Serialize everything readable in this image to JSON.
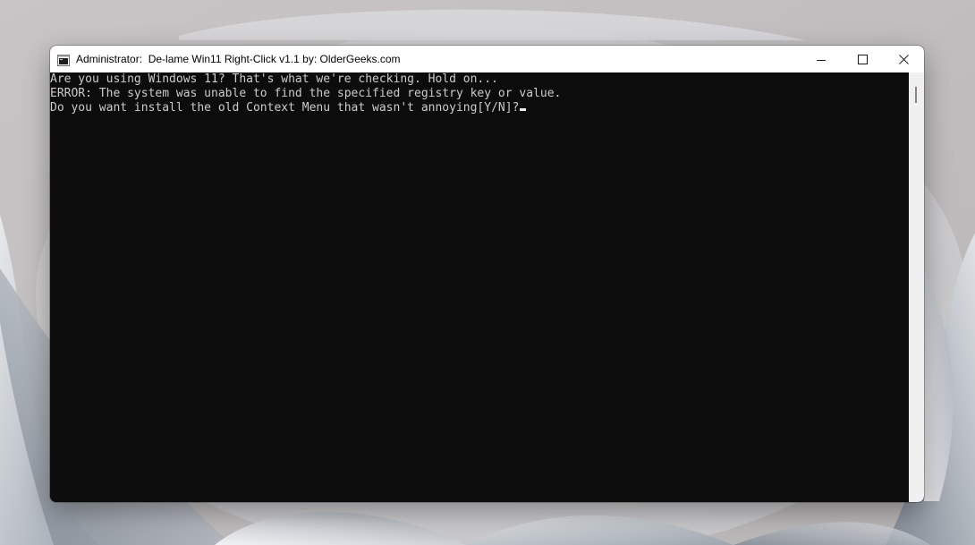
{
  "window": {
    "title": "Administrator:  De-lame Win11 Right-Click v1.1 by: OlderGeeks.com",
    "icon": "console-icon",
    "controls": {
      "minimize_icon": "minimize-icon",
      "maximize_icon": "maximize-icon",
      "close_icon": "close-icon"
    }
  },
  "console": {
    "lines": [
      "Are you using Windows 11? That's what we're checking. Hold on...",
      "ERROR: The system was unable to find the specified registry key or value.",
      "Do you want install the old Context Menu that wasn't annoying[Y/N]?"
    ],
    "text_color": "#cccccc",
    "background_color": "#0c0c0c"
  }
}
